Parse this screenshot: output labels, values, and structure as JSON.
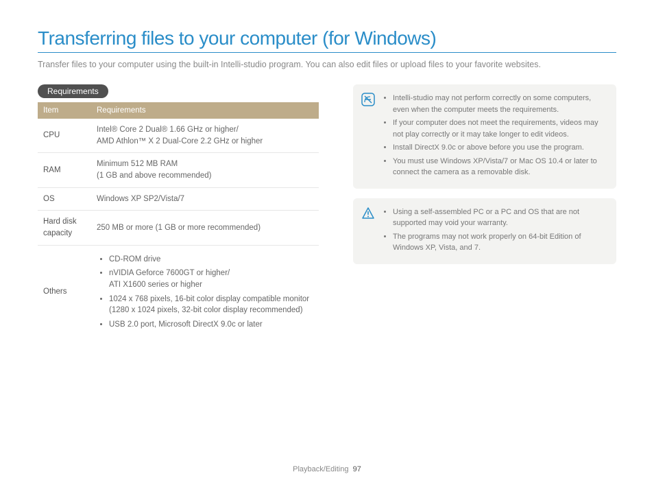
{
  "title": "Transferring files to your computer (for Windows)",
  "subtitle": "Transfer files to your computer using the built-in Intelli-studio program. You can also edit files or upload files to your favorite websites.",
  "requirements_badge": "Requirements",
  "table": {
    "head_item": "Item",
    "head_req": "Requirements",
    "rows": {
      "cpu_label": "CPU",
      "cpu_value": "Intel® Core 2 Dual® 1.66 GHz or higher/\nAMD Athlon™ X 2 Dual-Core 2.2 GHz or higher",
      "ram_label": "RAM",
      "ram_value": "Minimum 512 MB RAM\n(1 GB and above recommended)",
      "os_label": "OS",
      "os_value": "Windows XP SP2/Vista/7",
      "hdd_label": "Hard disk capacity",
      "hdd_value": "250 MB or more (1 GB or more recommended)",
      "others_label": "Others",
      "others_items": {
        "0": "CD-ROM drive",
        "1": "nVIDIA Geforce 7600GT or higher/\nATI X1600 series or higher",
        "2": "1024 x 768 pixels, 16-bit color display compatible monitor (1280 x 1024 pixels, 32-bit color display recommended)",
        "3": "USB 2.0 port, Microsoft DirectX 9.0c or later"
      }
    }
  },
  "note1": {
    "0": "Intelli-studio may not perform correctly on some computers, even when the computer meets the requirements.",
    "1": "If your computer does not meet the requirements, videos may not play correctly or it may take longer to edit videos.",
    "2": "Install DirectX 9.0c or above before you use the program.",
    "3": "You must use Windows XP/Vista/7 or Mac OS 10.4 or later to connect the camera as a removable disk."
  },
  "note2": {
    "0": "Using a self-assembled PC or a PC and OS that are not supported may void your warranty.",
    "1": "The programs may not work properly on 64-bit Edition of Windows XP, Vista, and 7."
  },
  "footer_section": "Playback/Editing",
  "footer_page": "97"
}
